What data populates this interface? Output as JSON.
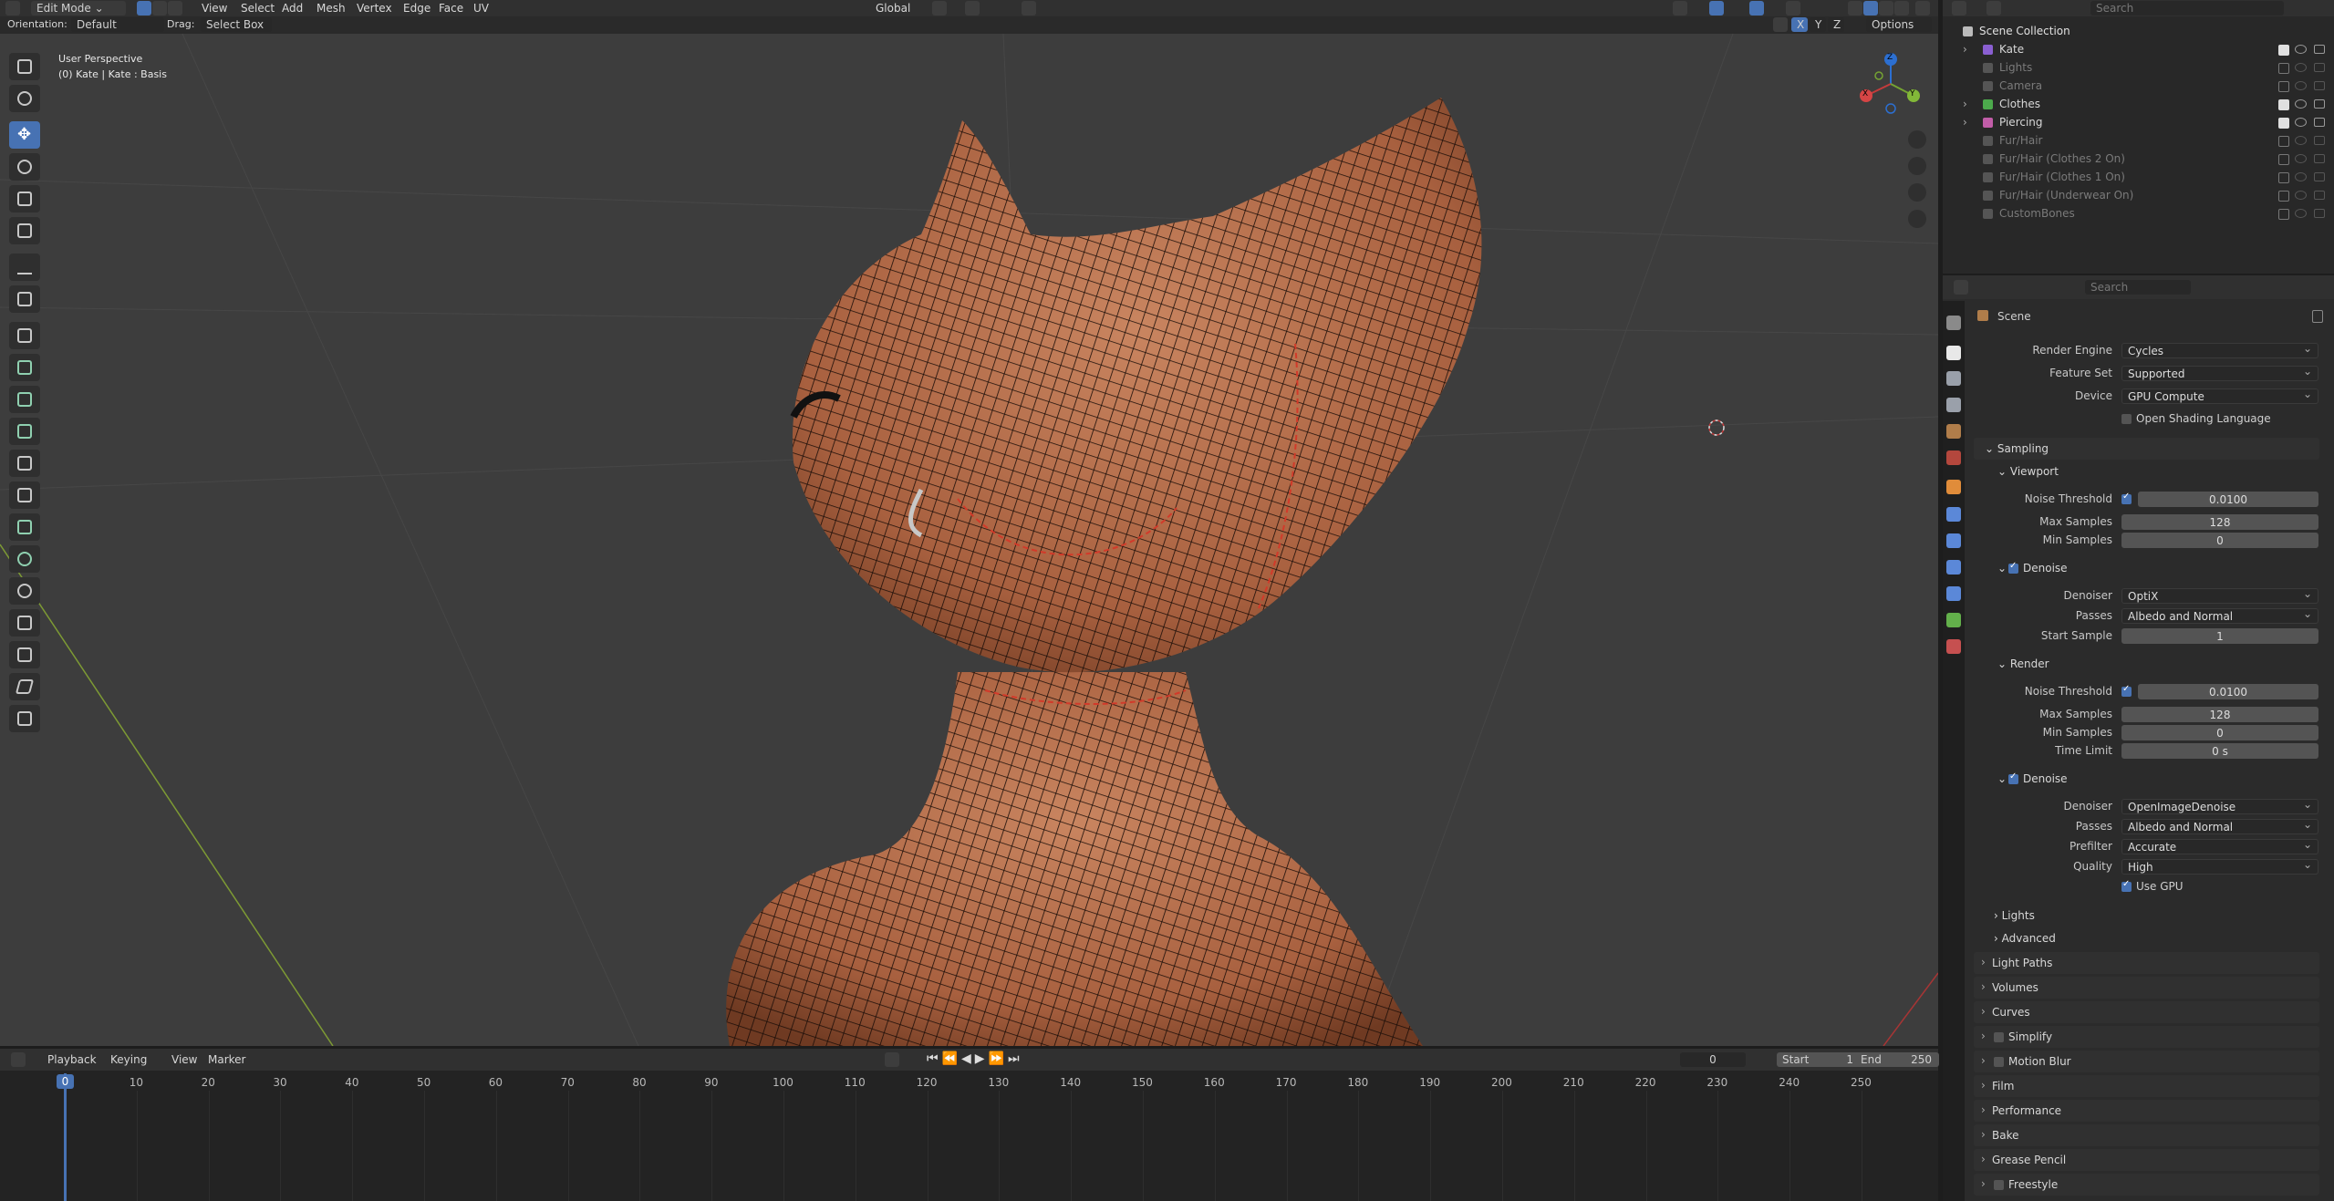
{
  "header": {
    "mode": "Edit Mode",
    "menus": [
      "View",
      "Select",
      "Add",
      "Mesh",
      "Vertex",
      "Edge",
      "Face",
      "UV"
    ],
    "transform_orientation": "Global",
    "search_placeholder": "Search"
  },
  "tool_header": {
    "orientation_label": "Orientation:",
    "orientation_value": "Default",
    "drag_label": "Drag:",
    "drag_value": "Select Box",
    "axis_x": "X",
    "axis_y": "Y",
    "axis_z": "Z",
    "options": "Options"
  },
  "viewport": {
    "overlay_title": "User Perspective",
    "overlay_object": "(0) Kate | Kate : Basis",
    "gizmo": {
      "x": "X",
      "y": "Y",
      "z": "Z"
    },
    "tools": [
      "select-box-icon",
      "cursor-icon",
      "move-icon",
      "rotate-icon",
      "scale-icon",
      "transform-icon",
      "annotate-icon",
      "measure-icon",
      "add-cube-icon",
      "extrude-icon",
      "inset-icon",
      "bevel-icon",
      "loop-cut-icon",
      "knife-icon",
      "poly-build-icon",
      "spin-icon",
      "smooth-icon",
      "edge-slide-icon",
      "shrink-icon",
      "shear-icon",
      "rip-icon"
    ]
  },
  "timeline": {
    "menus": [
      "Playback",
      "Keying",
      "View",
      "Marker"
    ],
    "current_frame": "0",
    "start_label": "Start",
    "start_value": "1",
    "end_label": "End",
    "end_value": "250",
    "ticks": [
      "0",
      "10",
      "20",
      "30",
      "40",
      "50",
      "60",
      "70",
      "80",
      "90",
      "100",
      "110",
      "120",
      "130",
      "140",
      "150",
      "160",
      "170",
      "180",
      "190",
      "200",
      "210",
      "220",
      "230",
      "240",
      "250"
    ]
  },
  "outliner": {
    "search_placeholder": "Search",
    "root": "Scene Collection",
    "items": [
      {
        "name": "Kate",
        "color": "#8a5fd1",
        "enabled": true,
        "dim": false
      },
      {
        "name": "Lights",
        "color": "#555555",
        "enabled": false,
        "dim": true
      },
      {
        "name": "Camera",
        "color": "#555555",
        "enabled": false,
        "dim": true
      },
      {
        "name": "Clothes",
        "color": "#4caa4c",
        "enabled": true,
        "dim": false
      },
      {
        "name": "Piercing",
        "color": "#c15da8",
        "enabled": true,
        "dim": false
      },
      {
        "name": "Fur/Hair",
        "color": "#555555",
        "enabled": false,
        "dim": true
      },
      {
        "name": "Fur/Hair (Clothes 2 On)",
        "color": "#555555",
        "enabled": false,
        "dim": true
      },
      {
        "name": "Fur/Hair (Clothes 1 On)",
        "color": "#555555",
        "enabled": false,
        "dim": true
      },
      {
        "name": "Fur/Hair (Underwear On)",
        "color": "#555555",
        "enabled": false,
        "dim": true
      },
      {
        "name": "CustomBones",
        "color": "#555555",
        "enabled": false,
        "dim": true
      }
    ]
  },
  "properties": {
    "search_placeholder": "Search",
    "context": "Scene",
    "render_engine_label": "Render Engine",
    "render_engine": "Cycles",
    "feature_set_label": "Feature Set",
    "feature_set": "Supported",
    "device_label": "Device",
    "device": "GPU Compute",
    "osl": "Open Shading Language",
    "sampling": "Sampling",
    "viewport": "Viewport",
    "noise_threshold_label": "Noise Threshold",
    "vp_noise_threshold": "0.0100",
    "max_samples_label": "Max Samples",
    "vp_max_samples": "128",
    "min_samples_label": "Min Samples",
    "vp_min_samples": "0",
    "denoise": "Denoise",
    "denoiser_label": "Denoiser",
    "vp_denoiser": "OptiX",
    "passes_label": "Passes",
    "vp_passes": "Albedo and Normal",
    "start_sample_label": "Start Sample",
    "vp_start_sample": "1",
    "render": "Render",
    "r_noise_threshold": "0.0100",
    "r_max_samples": "128",
    "r_min_samples": "0",
    "time_limit_label": "Time Limit",
    "r_time_limit": "0 s",
    "r_denoiser": "OpenImageDenoise",
    "r_passes": "Albedo and Normal",
    "prefilter_label": "Prefilter",
    "r_prefilter": "Accurate",
    "quality_label": "Quality",
    "r_quality": "High",
    "use_gpu": "Use GPU",
    "sub_lights": "Lights",
    "sub_advanced": "Advanced",
    "panels": [
      "Light Paths",
      "Volumes",
      "Curves",
      "Simplify",
      "Motion Blur",
      "Film",
      "Performance",
      "Bake",
      "Grease Pencil",
      "Freestyle"
    ]
  }
}
